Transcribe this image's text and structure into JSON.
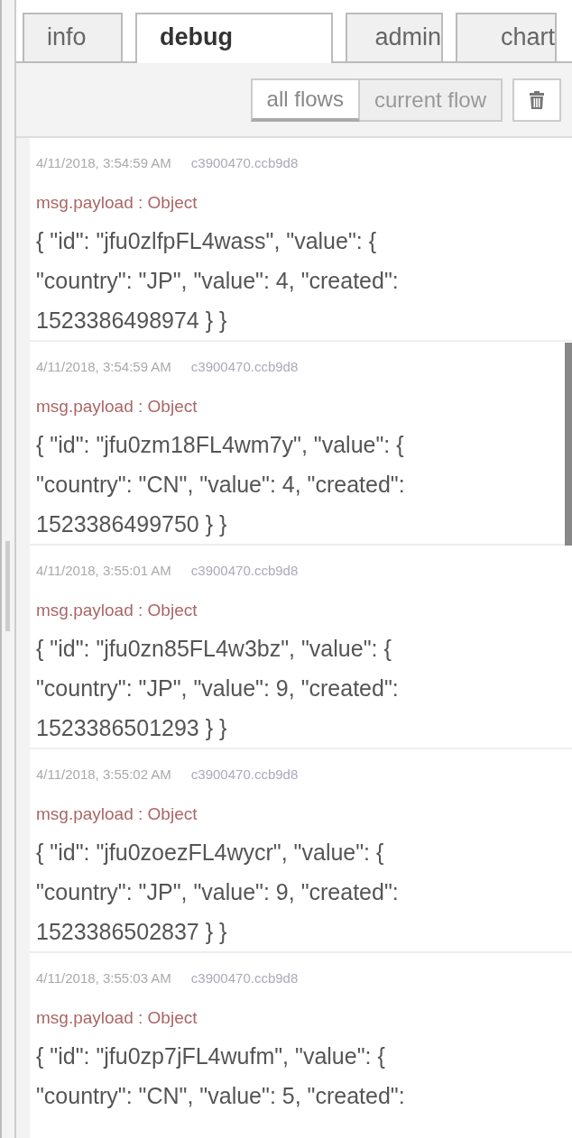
{
  "tabs": [
    {
      "label": "info",
      "selected": false
    },
    {
      "label": "debug",
      "selected": true
    },
    {
      "label": "admin",
      "selected": false
    },
    {
      "label": "chart",
      "selected": false
    }
  ],
  "filter": [
    {
      "label": "all flows",
      "selected": true
    },
    {
      "label": "current flow",
      "selected": false
    }
  ],
  "messages": [
    {
      "time": "4/11/2018, 3:54:59 AM",
      "node": "c3900470.ccb9d8",
      "type": "msg.payload : Object",
      "payload": [
        "{ \"id\": \"jfu0zlfpFL4wass\", \"value\": {",
        "\"country\": \"JP\", \"value\": 4, \"created\":",
        "1523386498974 } }"
      ]
    },
    {
      "time": "4/11/2018, 3:54:59 AM",
      "node": "c3900470.ccb9d8",
      "type": "msg.payload : Object",
      "payload": [
        "{ \"id\": \"jfu0zm18FL4wm7y\", \"value\": {",
        "\"country\": \"CN\", \"value\": 4, \"created\":",
        "1523386499750 } }"
      ]
    },
    {
      "time": "4/11/2018, 3:55:01 AM",
      "node": "c3900470.ccb9d8",
      "type": "msg.payload : Object",
      "payload": [
        "{ \"id\": \"jfu0zn85FL4w3bz\", \"value\": {",
        "\"country\": \"JP\", \"value\": 9, \"created\":",
        "1523386501293 } }"
      ]
    },
    {
      "time": "4/11/2018, 3:55:02 AM",
      "node": "c3900470.ccb9d8",
      "type": "msg.payload : Object",
      "payload": [
        "{ \"id\": \"jfu0zoezFL4wycr\", \"value\": {",
        "\"country\": \"JP\", \"value\": 9, \"created\":",
        "1523386502837 } }"
      ]
    },
    {
      "time": "4/11/2018, 3:55:03 AM",
      "node": "c3900470.ccb9d8",
      "type": "msg.payload : Object",
      "payload": [
        "{ \"id\": \"jfu0zp7jFL4wufm\", \"value\": {",
        "\"country\": \"CN\", \"value\": 5, \"created\":"
      ]
    }
  ]
}
